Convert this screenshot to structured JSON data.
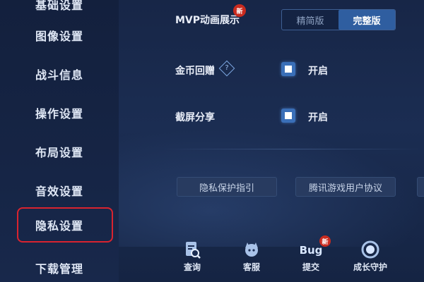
{
  "sidebar": {
    "items": [
      {
        "label": "基础设置"
      },
      {
        "label": "图像设置"
      },
      {
        "label": "战斗信息"
      },
      {
        "label": "操作设置"
      },
      {
        "label": "布局设置"
      },
      {
        "label": "音效设置"
      },
      {
        "label": "隐私设置"
      },
      {
        "label": "下载管理"
      }
    ],
    "highlighted": "隐私设置",
    "highlight_color": "#d9232f"
  },
  "settings": {
    "mvp": {
      "label": "MVP动画展示",
      "badge": "新",
      "options": [
        "精简版",
        "完整版"
      ],
      "selected": "完整版"
    },
    "coin_gift": {
      "label": "金币回赠",
      "help_icon": "question-icon",
      "checked": true,
      "value_label": "开启"
    },
    "screenshot_share": {
      "label": "截屏分享",
      "checked": true,
      "value_label": "开启"
    }
  },
  "links": {
    "privacy_guide": "隐私保护指引",
    "user_agreement": "腾讯游戏用户协议"
  },
  "bottom_bar": {
    "query": {
      "label": "查询",
      "icon": "document-search-icon"
    },
    "service": {
      "label": "客服",
      "icon": "headset-icon"
    },
    "bug_report": {
      "label": "提交",
      "icon_text": "Bug",
      "badge": "新"
    },
    "guardian": {
      "label": "成长守护",
      "icon": "shield-ring-icon"
    }
  },
  "colors": {
    "accent": "#2f5ea0",
    "checkbox": "#3a6fb8",
    "badge": "#c92b1f"
  }
}
